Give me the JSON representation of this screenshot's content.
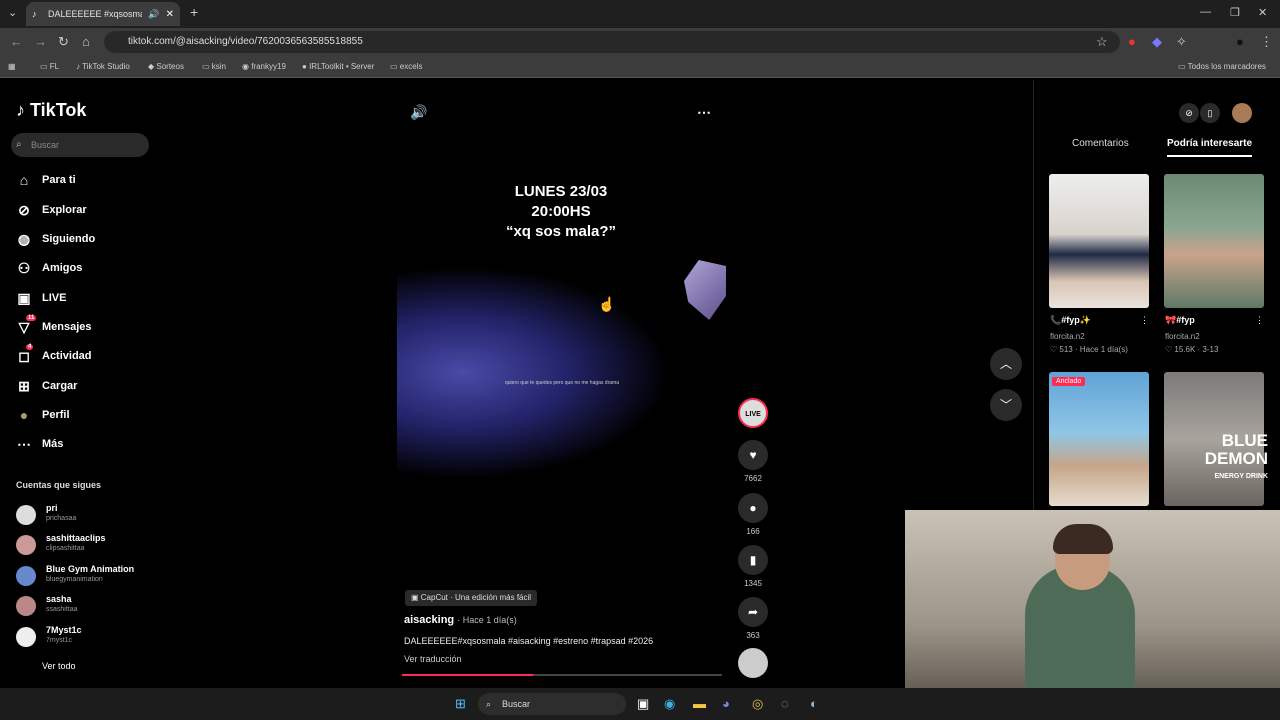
{
  "browser": {
    "tab_title": "DALEEEEEE #xqsosmala #ai...",
    "url": "tiktok.com/@aisacking/video/7620036563585518855",
    "bookmarks": [
      "FL",
      "TikTok Studio",
      "Sorteos",
      "ksin",
      "frankyy19",
      "IRLToolkit • Server",
      "excels"
    ],
    "all_bookmarks": "Todos los marcadores"
  },
  "sidebar": {
    "logo": "TikTok",
    "search_placeholder": "Buscar",
    "nav": [
      {
        "label": "Para ti",
        "icon": "home-icon"
      },
      {
        "label": "Explorar",
        "icon": "compass-icon"
      },
      {
        "label": "Siguiendo",
        "icon": "following-avatar-icon"
      },
      {
        "label": "Amigos",
        "icon": "friends-icon"
      },
      {
        "label": "LIVE",
        "icon": "live-icon"
      },
      {
        "label": "Mensajes",
        "icon": "messages-icon",
        "badge": "11"
      },
      {
        "label": "Actividad",
        "icon": "activity-icon",
        "badge": "4"
      },
      {
        "label": "Cargar",
        "icon": "upload-icon"
      },
      {
        "label": "Perfil",
        "icon": "profile-avatar-icon"
      },
      {
        "label": "Más",
        "icon": "more-icon"
      }
    ],
    "following_header": "Cuentas que sigues",
    "accounts": [
      {
        "name": "pri",
        "handle": "prichasaa"
      },
      {
        "name": "sashittaaclips",
        "handle": "clipsashittaa"
      },
      {
        "name": "Blue Gym Animation",
        "handle": "bluegymanimation"
      },
      {
        "name": "sasha",
        "handle": "ssashittaa"
      },
      {
        "name": "7Myst1c",
        "handle": "7myst1c"
      }
    ],
    "see_all": "Ver todo"
  },
  "video": {
    "overlay_text_1": "LUNES 23/03",
    "overlay_text_2": "20:00HS",
    "overlay_text_3": "“xq sos mala?”",
    "lyric": "quiero que te quedes pero que no me hagas drama",
    "capcut": "CapCut · Una edición más fácil",
    "author": "aisacking",
    "time": "· Hace 1 día(s)",
    "description": "DALEEEEEE#xqsosmala #aisacking #estreno #trapsad #2026",
    "translate": "Ver traducción",
    "progress": 0.41
  },
  "actions": {
    "live_badge": "LIVE",
    "likes": "7662",
    "comments": "166",
    "saves": "1345",
    "shares": "363"
  },
  "right": {
    "tab_comments": "Comentarios",
    "tab_suggestions": "Podría interesarte",
    "cards": [
      {
        "title": "📞#fyp✨",
        "author": "florcita.n2",
        "meta": "♡ 513 · Hace 1 día(s)"
      },
      {
        "title": "🎀#fyp",
        "author": "florcita.n2",
        "meta": "♡ 15.6K · 3-13"
      }
    ],
    "pinned": "Anclado"
  },
  "overlay_brand": {
    "line1": "BLUE",
    "line2": "DEMON",
    "line3": "ENERGY DRINK"
  },
  "taskbar": {
    "search": "Buscar"
  }
}
